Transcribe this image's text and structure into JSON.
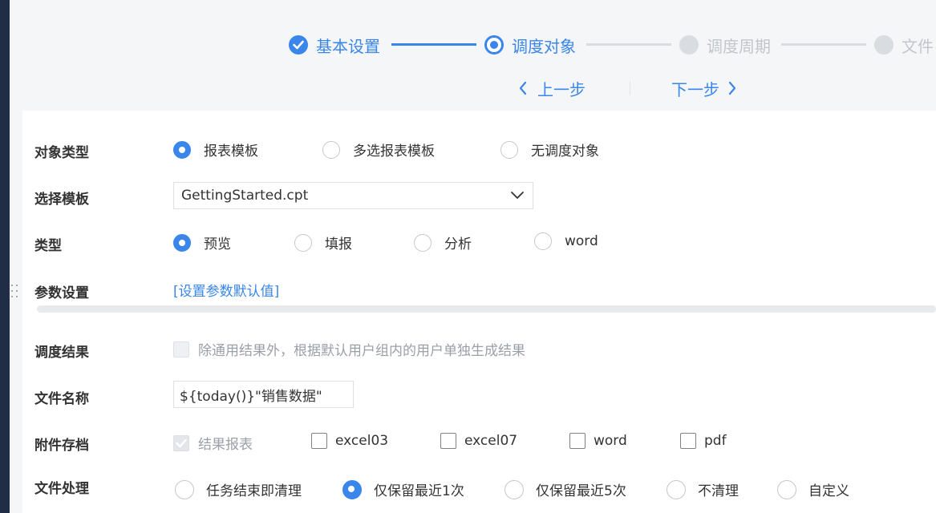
{
  "steps": [
    {
      "label": "基本设置",
      "state": "done"
    },
    {
      "label": "调度对象",
      "state": "active"
    },
    {
      "label": "调度周期",
      "state": "todo"
    },
    {
      "label": "文件",
      "state": "todo"
    }
  ],
  "nav": {
    "prev_label": "上一步",
    "next_label": "下一步"
  },
  "form": {
    "object_type": {
      "label": "对象类型",
      "options": [
        "报表模板",
        "多选报表模板",
        "无调度对象"
      ],
      "selected": "报表模板"
    },
    "template": {
      "label": "选择模板",
      "value": "GettingStarted.cpt"
    },
    "type": {
      "label": "类型",
      "options": [
        "预览",
        "填报",
        "分析",
        "word"
      ],
      "selected": "预览"
    },
    "params": {
      "label": "参数设置",
      "link": "[设置参数默认值]"
    },
    "result": {
      "label": "调度结果",
      "checkbox_text": "除通用结果外，根据默认用户组内的用户单独生成结果"
    },
    "file_name": {
      "label": "文件名称",
      "value": "${today()}\"销售数据\""
    },
    "attachment": {
      "label": "附件存档",
      "options": [
        "结果报表",
        "excel03",
        "excel07",
        "word",
        "pdf"
      ]
    },
    "file_handling": {
      "label": "文件处理",
      "options": [
        "任务结束即清理",
        "仅保留最近1次",
        "仅保留最近5次",
        "不清理",
        "自定义"
      ],
      "selected": "仅保留最近1次"
    }
  },
  "colors": {
    "accent": "#3a86ea",
    "sidebar": "#1f2d47",
    "inactive": "#d9dce1"
  },
  "icons": [
    "check-icon",
    "chevron-left-icon",
    "chevron-right-icon",
    "chevron-down-icon",
    "drag-handle-icon"
  ]
}
